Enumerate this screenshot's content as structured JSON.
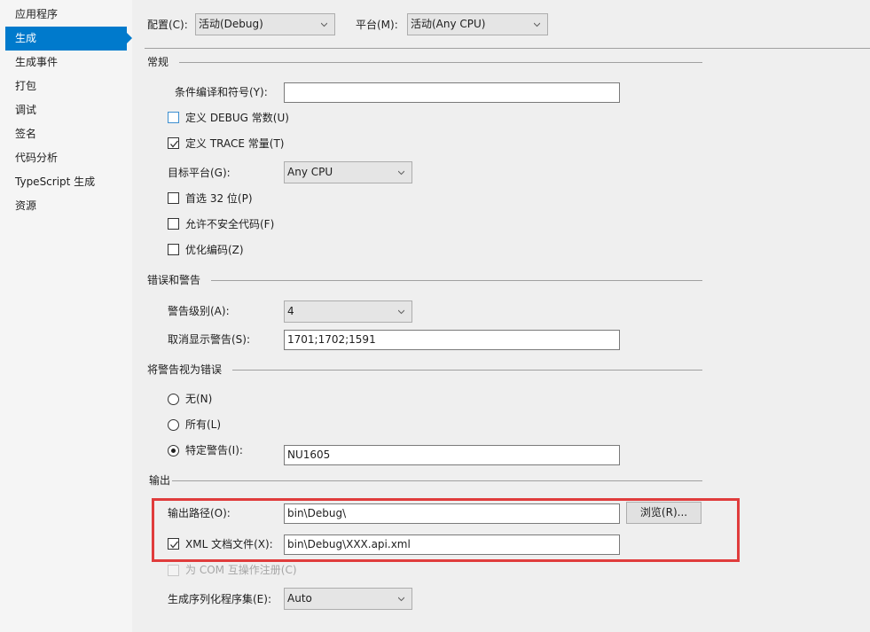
{
  "sidebar": {
    "items": [
      {
        "label": "应用程序",
        "active": false
      },
      {
        "label": "生成",
        "active": true
      },
      {
        "label": "生成事件",
        "active": false
      },
      {
        "label": "打包",
        "active": false
      },
      {
        "label": "调试",
        "active": false
      },
      {
        "label": "签名",
        "active": false
      },
      {
        "label": "代码分析",
        "active": false
      },
      {
        "label": "TypeScript 生成",
        "active": false
      },
      {
        "label": "资源",
        "active": false
      }
    ]
  },
  "header": {
    "config_label": "配置(C):",
    "config_value": "活动(Debug)",
    "platform_label": "平台(M):",
    "platform_value": "活动(Any CPU)"
  },
  "general": {
    "title": "常规",
    "conditional_symbols_label": "条件编译和符号(Y):",
    "conditional_symbols_value": "",
    "define_debug_label": "定义 DEBUG 常数(U)",
    "define_debug_checked": false,
    "define_trace_label": "定义 TRACE 常量(T)",
    "define_trace_checked": true,
    "platform_target_label": "目标平台(G):",
    "platform_target_value": "Any CPU",
    "prefer32_label": "首选 32 位(P)",
    "prefer32_checked": false,
    "unsafe_label": "允许不安全代码(F)",
    "unsafe_checked": false,
    "optimize_label": "优化编码(Z)",
    "optimize_checked": false
  },
  "errors": {
    "title": "错误和警告",
    "warning_level_label": "警告级别(A):",
    "warning_level_value": "4",
    "suppress_label": "取消显示警告(S):",
    "suppress_value": "1701;1702;1591"
  },
  "treat_warnings": {
    "title": "将警告视为错误",
    "none_label": "无(N)",
    "all_label": "所有(L)",
    "specific_label": "特定警告(I):",
    "selected": "specific",
    "specific_value": "NU1605"
  },
  "output": {
    "title": "输出",
    "output_path_label": "输出路径(O):",
    "output_path_value": "bin\\Debug\\",
    "browse_label": "浏览(R)...",
    "xml_doc_label": "XML 文档文件(X):",
    "xml_doc_checked": true,
    "xml_doc_value": "bin\\Debug\\XXX.api.xml",
    "com_interop_label": "为 COM 互操作注册(C)",
    "com_interop_checked": false,
    "com_interop_enabled": false,
    "serialization_label": "生成序列化程序集(E):",
    "serialization_value": "Auto"
  },
  "colors": {
    "accent": "#007acc",
    "highlight_border": "#e03c3c"
  }
}
